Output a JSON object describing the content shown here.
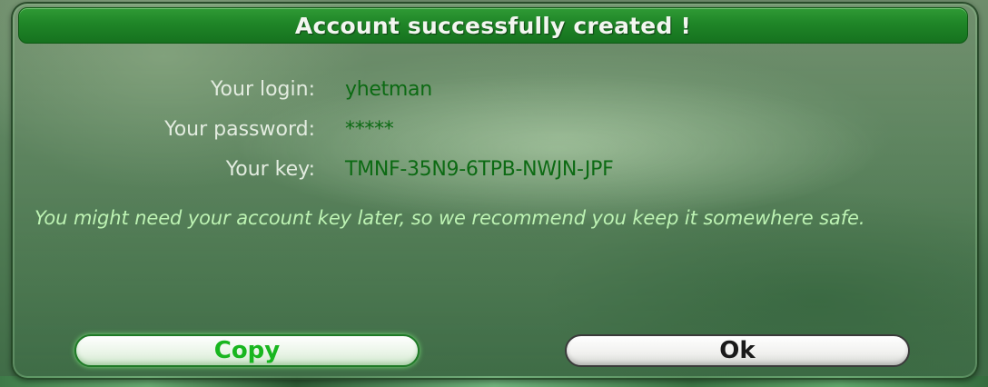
{
  "dialog": {
    "title": "Account successfully created !",
    "fields": [
      {
        "label": "Your login:",
        "value": "yhetman"
      },
      {
        "label": "Your password:",
        "value": "*****"
      },
      {
        "label": "Your key:",
        "value": "TMNF-35N9-6TPB-NWJN-JPF"
      }
    ],
    "notice": "You might need your account key later, so we recommend you keep it somewhere safe.",
    "buttons": {
      "copy_label": "Copy",
      "ok_label": "Ok"
    }
  },
  "colors": {
    "title_bar": "#1f8527",
    "value_text": "#0c6a13",
    "notice_text": "#bdf3b3",
    "copy_text": "#18b61f"
  }
}
